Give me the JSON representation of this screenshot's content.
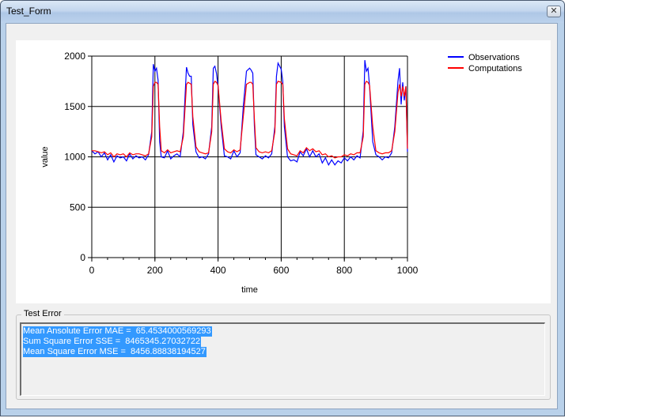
{
  "window": {
    "title": "Test_Form",
    "close_label": "✕"
  },
  "chart_data": {
    "type": "line",
    "xlabel": "time",
    "ylabel": "value",
    "xlim": [
      0,
      1000
    ],
    "ylim": [
      0,
      2000
    ],
    "xticks": [
      0,
      200,
      400,
      600,
      800,
      1000
    ],
    "yticks": [
      0,
      500,
      1000,
      1500,
      2000
    ],
    "grid": true,
    "legend_position": "top-right",
    "series": [
      {
        "name": "Observations",
        "color": "#0000ff",
        "x": [
          0,
          10,
          20,
          30,
          40,
          50,
          60,
          70,
          80,
          90,
          100,
          110,
          120,
          130,
          140,
          150,
          160,
          170,
          180,
          190,
          195,
          200,
          205,
          210,
          215,
          220,
          230,
          240,
          250,
          260,
          270,
          280,
          290,
          300,
          305,
          310,
          315,
          320,
          330,
          340,
          350,
          360,
          370,
          380,
          385,
          390,
          395,
          400,
          410,
          420,
          430,
          440,
          450,
          460,
          470,
          480,
          490,
          500,
          505,
          510,
          515,
          520,
          530,
          540,
          550,
          560,
          570,
          580,
          585,
          590,
          600,
          605,
          610,
          620,
          630,
          640,
          650,
          660,
          670,
          680,
          690,
          700,
          710,
          720,
          730,
          740,
          750,
          760,
          770,
          780,
          790,
          800,
          810,
          820,
          830,
          840,
          850,
          860,
          865,
          870,
          875,
          880,
          890,
          900,
          910,
          920,
          930,
          940,
          950,
          960,
          970,
          975,
          980,
          985,
          990,
          995,
          1000
        ],
        "y": [
          1060,
          1030,
          1050,
          1000,
          1040,
          970,
          1020,
          950,
          1010,
          990,
          1000,
          960,
          1030,
          980,
          1010,
          990,
          1000,
          970,
          1020,
          1250,
          1920,
          1850,
          1880,
          1760,
          1150,
          1000,
          990,
          1060,
          980,
          1010,
          1030,
          1000,
          1250,
          1890,
          1830,
          1800,
          1800,
          1320,
          1050,
          990,
          1000,
          980,
          1030,
          1300,
          1880,
          1900,
          1830,
          1700,
          1300,
          1010,
          1000,
          980,
          1060,
          1000,
          1040,
          1500,
          1850,
          1880,
          1860,
          1830,
          1310,
          1020,
          1000,
          980,
          1010,
          990,
          1030,
          1300,
          1800,
          1930,
          1870,
          1750,
          1300,
          1000,
          960,
          970,
          950,
          1050,
          1010,
          1080,
          1000,
          1060,
          1000,
          1030,
          940,
          990,
          920,
          970,
          920,
          960,
          940,
          990,
          960,
          1000,
          970,
          1010,
          990,
          1260,
          1960,
          1850,
          1880,
          1700,
          1150,
          1020,
          1000,
          970,
          1000,
          990,
          1040,
          1300,
          1750,
          1880,
          1520,
          1740,
          1560,
          1700,
          1050
        ]
      },
      {
        "name": "Computations",
        "color": "#ff0000",
        "x": [
          0,
          10,
          20,
          30,
          40,
          50,
          60,
          70,
          80,
          90,
          100,
          110,
          120,
          130,
          140,
          150,
          160,
          170,
          180,
          190,
          195,
          200,
          205,
          210,
          215,
          220,
          230,
          240,
          250,
          260,
          270,
          280,
          290,
          300,
          305,
          310,
          315,
          320,
          330,
          340,
          350,
          360,
          370,
          380,
          385,
          390,
          395,
          400,
          410,
          420,
          430,
          440,
          450,
          460,
          470,
          480,
          490,
          500,
          505,
          510,
          515,
          520,
          530,
          540,
          550,
          560,
          570,
          580,
          585,
          590,
          600,
          605,
          610,
          620,
          630,
          640,
          650,
          660,
          670,
          680,
          690,
          700,
          710,
          720,
          730,
          740,
          750,
          760,
          770,
          780,
          790,
          800,
          810,
          820,
          830,
          840,
          850,
          860,
          865,
          870,
          875,
          880,
          890,
          900,
          910,
          920,
          930,
          940,
          950,
          960,
          970,
          975,
          980,
          985,
          990,
          995,
          1000
        ],
        "y": [
          1060,
          1060,
          1050,
          1040,
          1050,
          1020,
          1040,
          1000,
          1030,
          1020,
          1030,
          1000,
          1040,
          1020,
          1030,
          1030,
          1020,
          1010,
          1030,
          1200,
          1700,
          1740,
          1740,
          1720,
          1300,
          1060,
          1040,
          1070,
          1040,
          1050,
          1060,
          1050,
          1200,
          1720,
          1740,
          1730,
          1720,
          1400,
          1100,
          1050,
          1040,
          1030,
          1040,
          1250,
          1720,
          1750,
          1740,
          1710,
          1350,
          1080,
          1050,
          1040,
          1070,
          1050,
          1070,
          1400,
          1720,
          1740,
          1740,
          1720,
          1380,
          1090,
          1050,
          1040,
          1050,
          1040,
          1060,
          1250,
          1720,
          1750,
          1740,
          1720,
          1380,
          1080,
          1030,
          1020,
          1010,
          1060,
          1040,
          1090,
          1060,
          1080,
          1050,
          1060,
          1020,
          1030,
          1000,
          1010,
          990,
          1000,
          1000,
          1020,
          1010,
          1030,
          1020,
          1040,
          1040,
          1200,
          1720,
          1750,
          1740,
          1710,
          1300,
          1060,
          1040,
          1030,
          1040,
          1040,
          1060,
          1250,
          1640,
          1720,
          1600,
          1700,
          1600,
          1700,
          1080
        ]
      }
    ]
  },
  "test_error": {
    "group_title": "Test Error",
    "lines": [
      "Mean Ansolute Error MAE =  65.4534000569293",
      "Sum Square Error SSE =  8465345.27032722",
      "Mean Square Error MSE =  8456.88838194527"
    ]
  }
}
